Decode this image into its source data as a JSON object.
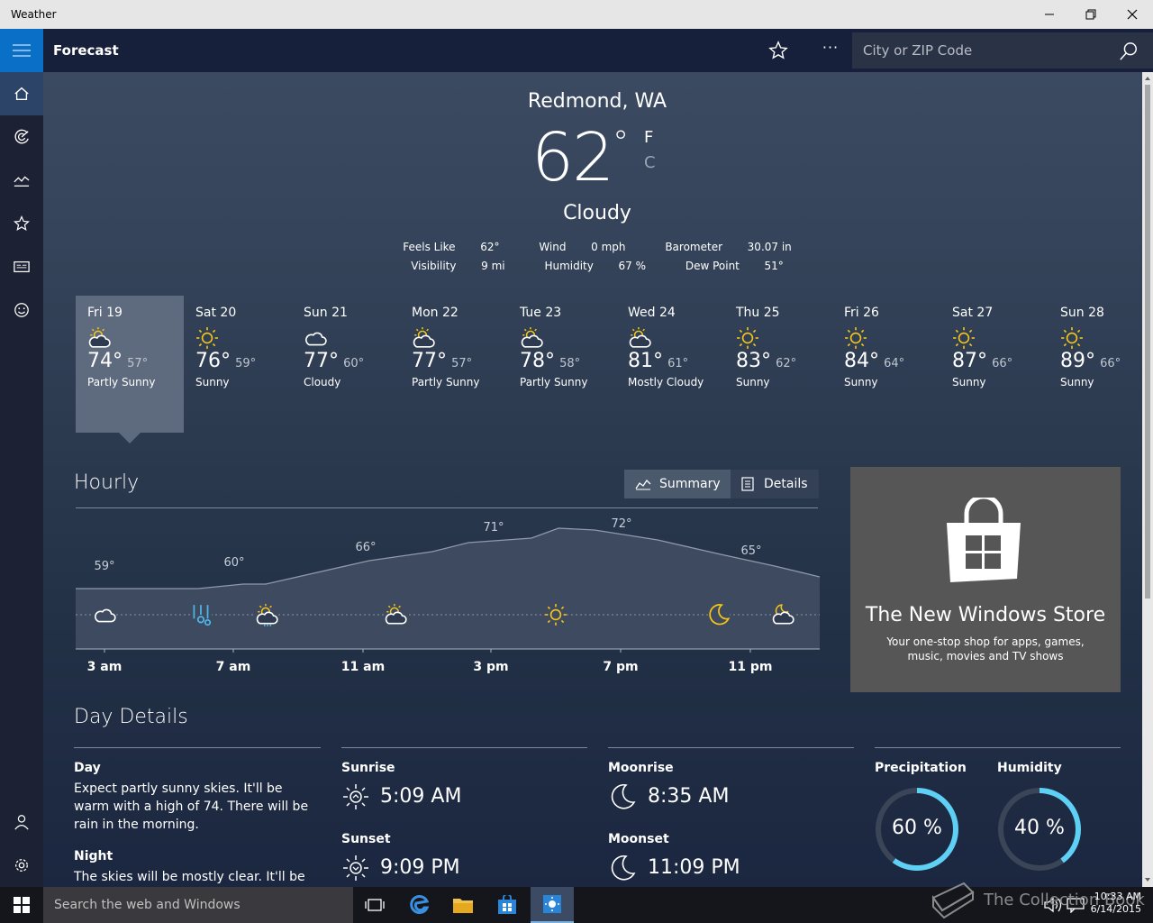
{
  "window": {
    "title": "Weather"
  },
  "appbar": {
    "title": "Forecast",
    "more_label": "···",
    "search_placeholder": "City or ZIP Code"
  },
  "current": {
    "location": "Redmond, WA",
    "temp": "62",
    "degree": "°",
    "unit_f": "F",
    "unit_c": "C",
    "condition": "Cloudy",
    "row1": [
      {
        "label": "Feels Like",
        "value": "62°"
      },
      {
        "label": "Wind",
        "value": "0 mph"
      },
      {
        "label": "Barometer",
        "value": "30.07 in"
      }
    ],
    "row2": [
      {
        "label": "Visibility",
        "value": "9 mi"
      },
      {
        "label": "Humidity",
        "value": "67 %"
      },
      {
        "label": "Dew Point",
        "value": "51°"
      }
    ]
  },
  "forecast": [
    {
      "day": "Fri 19",
      "hi": "74°",
      "lo": "57°",
      "cond": "Partly Sunny",
      "icon": "partly-sunny"
    },
    {
      "day": "Sat 20",
      "hi": "76°",
      "lo": "59°",
      "cond": "Sunny",
      "icon": "sunny"
    },
    {
      "day": "Sun 21",
      "hi": "77°",
      "lo": "60°",
      "cond": "Cloudy",
      "icon": "cloudy"
    },
    {
      "day": "Mon 22",
      "hi": "77°",
      "lo": "57°",
      "cond": "Partly Sunny",
      "icon": "partly-sunny"
    },
    {
      "day": "Tue 23",
      "hi": "78°",
      "lo": "58°",
      "cond": "Partly Sunny",
      "icon": "partly-sunny"
    },
    {
      "day": "Wed 24",
      "hi": "81°",
      "lo": "61°",
      "cond": "Mostly Cloudy",
      "icon": "partly-sunny"
    },
    {
      "day": "Thu 25",
      "hi": "83°",
      "lo": "62°",
      "cond": "Sunny",
      "icon": "sunny"
    },
    {
      "day": "Fri 26",
      "hi": "84°",
      "lo": "64°",
      "cond": "Sunny",
      "icon": "sunny"
    },
    {
      "day": "Sat 27",
      "hi": "87°",
      "lo": "66°",
      "cond": "Sunny",
      "icon": "sunny"
    },
    {
      "day": "Sun 28",
      "hi": "89°",
      "lo": "66°",
      "cond": "Sunny",
      "icon": "sunny"
    }
  ],
  "hourly": {
    "title": "Hourly",
    "summary_label": "Summary",
    "details_label": "Details",
    "temp_labels": [
      "59°",
      "60°",
      "66°",
      "71°",
      "72°",
      "65°"
    ],
    "time_labels": [
      "3 am",
      "7 am",
      "11 am",
      "3 pm",
      "7 pm",
      "11 pm"
    ],
    "icons": [
      "cloudy",
      "rain",
      "partly-sunny-rain",
      "partly-sunny",
      "sunny",
      "moon",
      "partly-cloudy-night"
    ]
  },
  "ad": {
    "title": "The New Windows Store",
    "subtitle": "Your one-stop shop for apps, games, music, movies and TV shows"
  },
  "day_details": {
    "title": "Day Details",
    "day_label": "Day",
    "day_text": "Expect partly sunny skies. It'll be warm with a high of 74. There will be rain in the morning.",
    "night_label": "Night",
    "night_text": "The skies will be mostly clear. It'll be",
    "sunrise_label": "Sunrise",
    "sunrise": "5:09 AM",
    "sunset_label": "Sunset",
    "sunset": "9:09 PM",
    "moonrise_label": "Moonrise",
    "moonrise": "8:35 AM",
    "moonset_label": "Moonset",
    "moonset": "11:09 PM",
    "precip_label": "Precipitation",
    "precip_value": "60 %",
    "precip_fraction": 0.6,
    "humidity_label": "Humidity",
    "humidity_value": "40 %",
    "humidity_fraction": 0.4,
    "ring_color": "#5fd0f5"
  },
  "taskbar": {
    "search_placeholder": "Search the web and Windows",
    "time": "10:33 AM",
    "date": "6/14/2015",
    "watermark": "The Collection Book"
  }
}
